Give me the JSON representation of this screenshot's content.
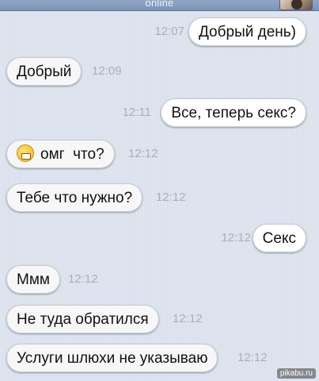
{
  "header": {
    "status": "online"
  },
  "messages": [
    {
      "text": "Добрый день)",
      "time": "12:07"
    },
    {
      "text": "Добрый",
      "time": "12:09"
    },
    {
      "text": "Все, теперь секс?",
      "time": "12:11"
    },
    {
      "text": "омг  что?",
      "time": "12:12",
      "icon": "grimace-emoji-icon"
    },
    {
      "text": "Тебе что нужно?",
      "time": "12:12"
    },
    {
      "text": "Секс",
      "time": "12:12"
    },
    {
      "text": "Ммм",
      "time": "12:12"
    },
    {
      "text": "Не туда обратился",
      "time": "12:12"
    },
    {
      "text": "Услуги шлюхи не указываю",
      "time": "12:12"
    }
  ],
  "watermark": "pikabu.ru",
  "colors": {
    "background": "#dbe2ed",
    "timestamp": "#a7afbe"
  }
}
